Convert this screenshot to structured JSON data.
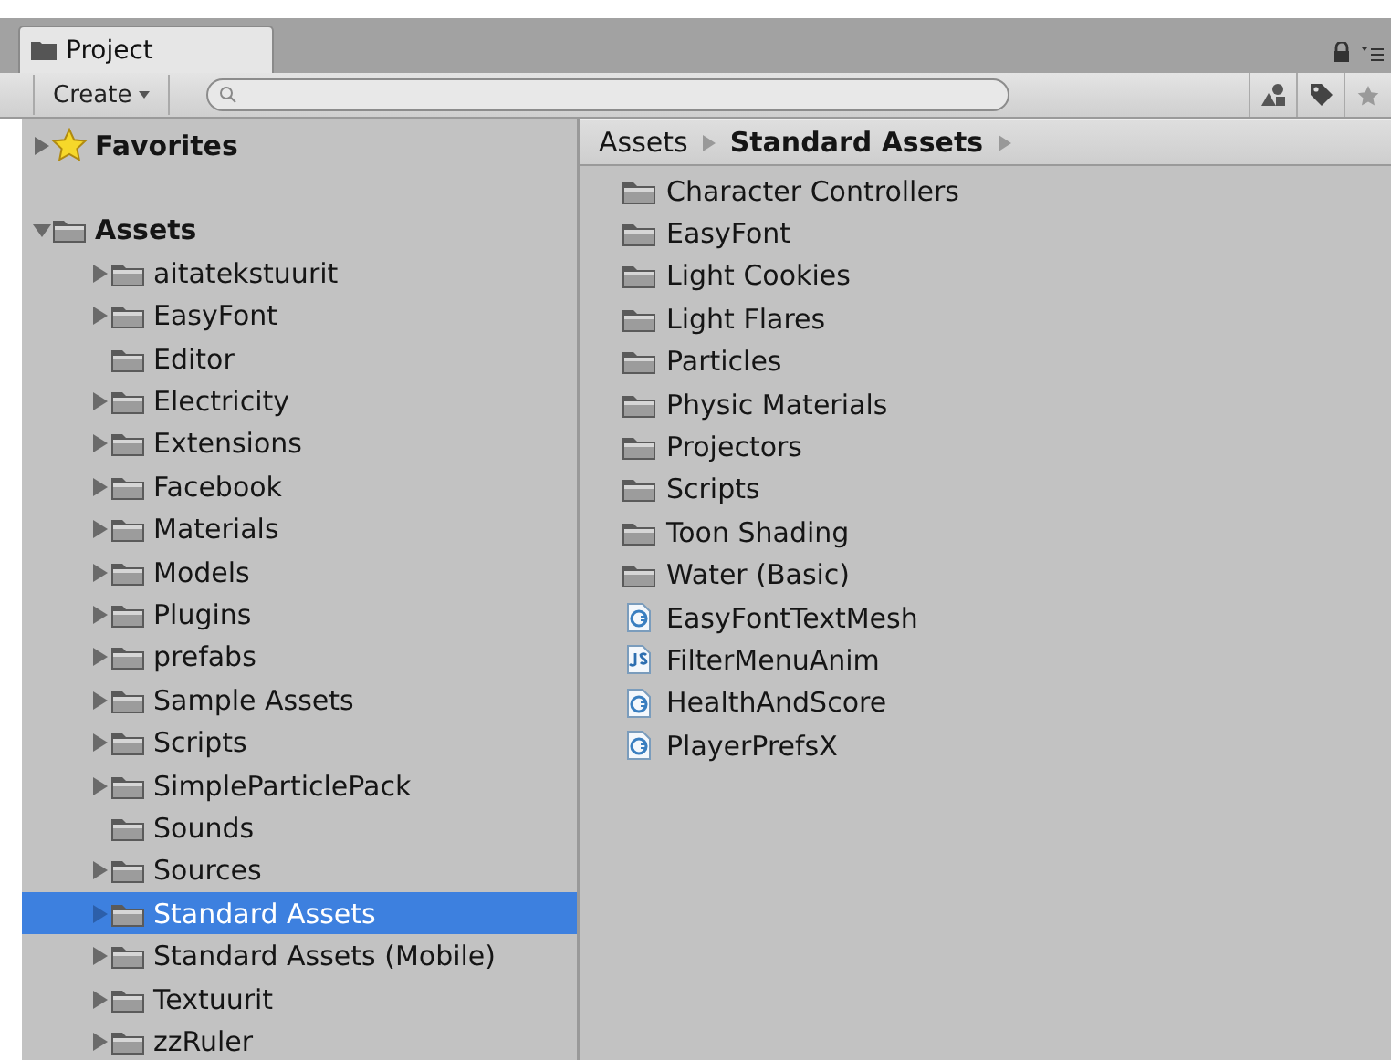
{
  "tab": {
    "label": "Project",
    "selected": true
  },
  "toolbar": {
    "create_button": "Create"
  },
  "tree": [
    {
      "label": "Favorites",
      "kind": "favorites",
      "expanded": false,
      "selected": false
    },
    {
      "label": "Assets",
      "kind": "folder",
      "expanded": true,
      "selected": false,
      "children": [
        {
          "label": "aitatekstuurit",
          "expandable": true,
          "selected": false
        },
        {
          "label": "EasyFont",
          "expandable": true,
          "selected": false
        },
        {
          "label": "Editor",
          "expandable": false,
          "selected": false
        },
        {
          "label": "Electricity",
          "expandable": true,
          "selected": false
        },
        {
          "label": "Extensions",
          "expandable": true,
          "selected": false
        },
        {
          "label": "Facebook",
          "expandable": true,
          "selected": false
        },
        {
          "label": "Materials",
          "expandable": true,
          "selected": false
        },
        {
          "label": "Models",
          "expandable": true,
          "selected": false
        },
        {
          "label": "Plugins",
          "expandable": true,
          "selected": false
        },
        {
          "label": "prefabs",
          "expandable": true,
          "selected": false
        },
        {
          "label": "Sample Assets",
          "expandable": true,
          "selected": false
        },
        {
          "label": "Scripts",
          "expandable": true,
          "selected": false
        },
        {
          "label": "SimpleParticlePack",
          "expandable": true,
          "selected": false
        },
        {
          "label": "Sounds",
          "expandable": false,
          "selected": false
        },
        {
          "label": "Sources",
          "expandable": true,
          "selected": false
        },
        {
          "label": "Standard Assets",
          "expandable": true,
          "selected": true
        },
        {
          "label": "Standard Assets (Mobile)",
          "expandable": true,
          "selected": false
        },
        {
          "label": "Textuurit",
          "expandable": true,
          "selected": false
        },
        {
          "label": "zzRuler",
          "expandable": true,
          "selected": false
        }
      ]
    }
  ],
  "breadcrumb": [
    {
      "label": "Assets",
      "current": false
    },
    {
      "label": "Standard Assets",
      "current": true
    }
  ],
  "files": [
    {
      "name": "Character Controllers",
      "kind": "folder"
    },
    {
      "name": "EasyFont",
      "kind": "folder"
    },
    {
      "name": "Light Cookies",
      "kind": "folder"
    },
    {
      "name": "Light Flares",
      "kind": "folder"
    },
    {
      "name": "Particles",
      "kind": "folder"
    },
    {
      "name": "Physic Materials",
      "kind": "folder"
    },
    {
      "name": "Projectors",
      "kind": "folder"
    },
    {
      "name": "Scripts",
      "kind": "folder"
    },
    {
      "name": "Toon Shading",
      "kind": "folder"
    },
    {
      "name": "Water (Basic)",
      "kind": "folder"
    },
    {
      "name": "EasyFontTextMesh",
      "kind": "csharp"
    },
    {
      "name": "FilterMenuAnim",
      "kind": "js"
    },
    {
      "name": "HealthAndScore",
      "kind": "csharp"
    },
    {
      "name": "PlayerPrefsX",
      "kind": "csharp"
    }
  ]
}
